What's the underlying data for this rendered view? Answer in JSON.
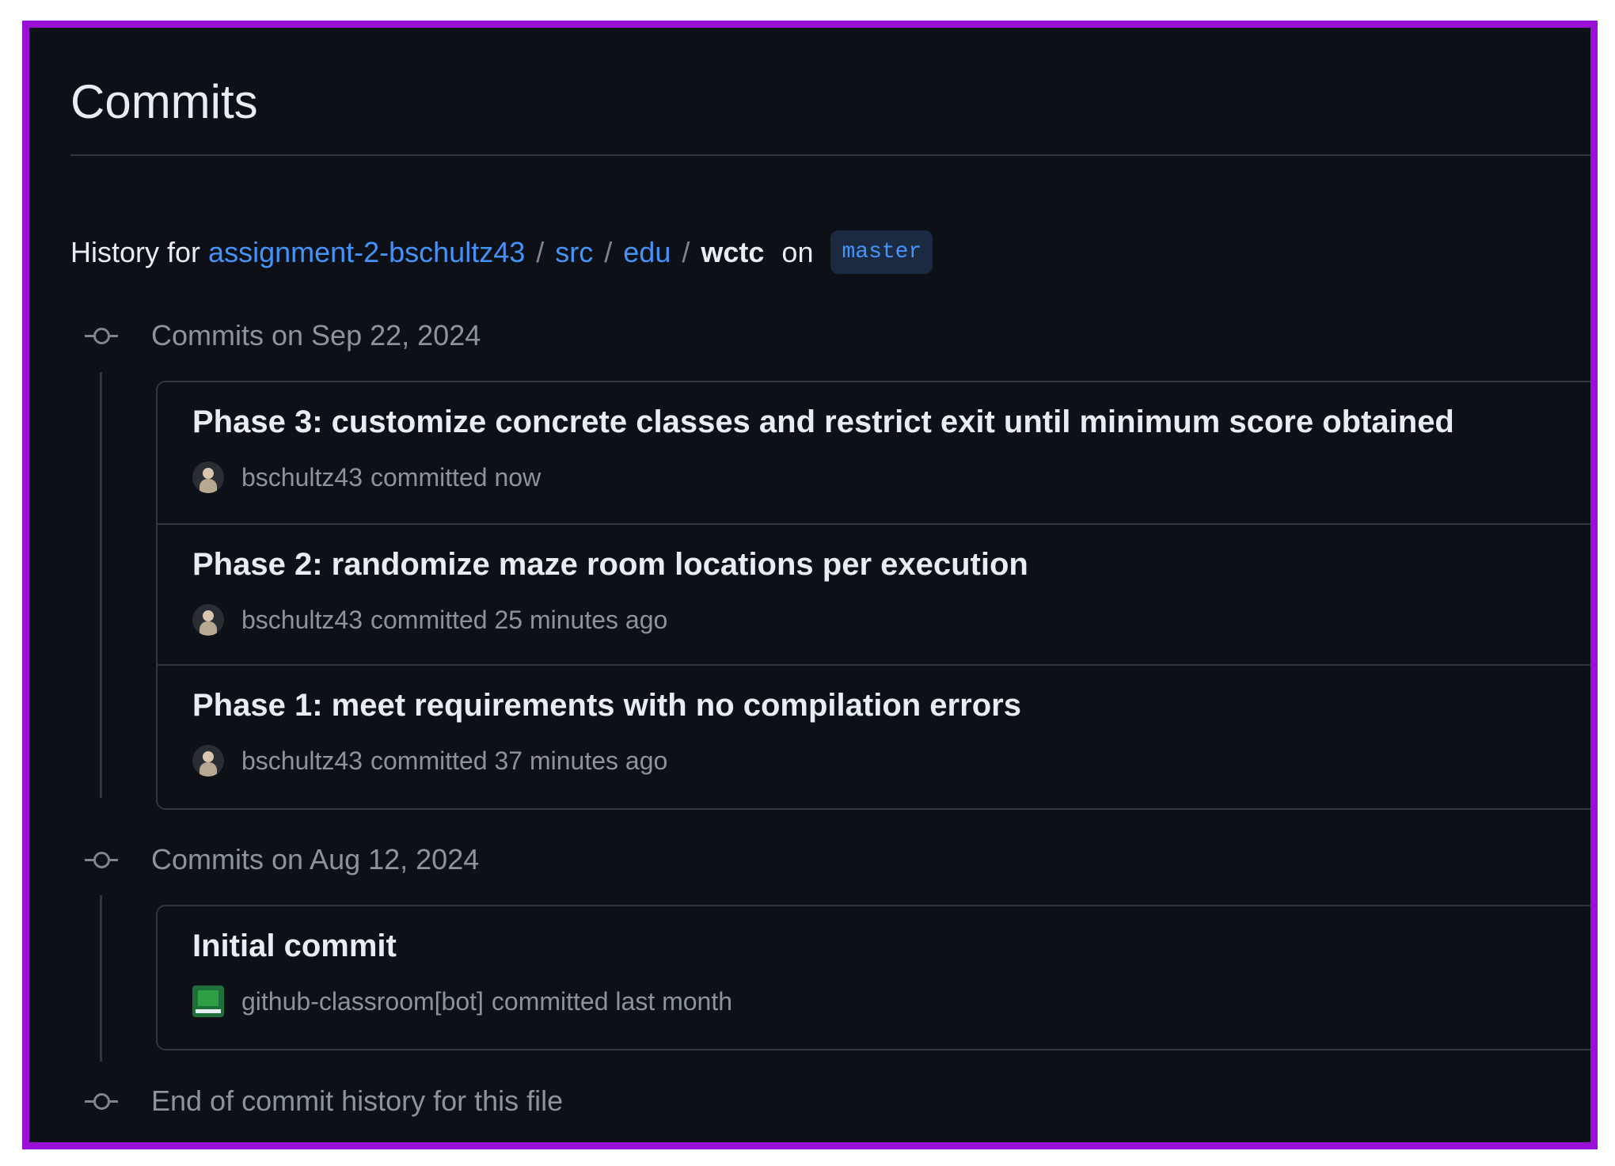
{
  "page": {
    "title": "Commits"
  },
  "history": {
    "prefix": "History for",
    "path": [
      "assignment-2-bschultz43",
      "src",
      "edu"
    ],
    "current": "wctc",
    "separator": "/",
    "on_label": "on",
    "branch": "master"
  },
  "groups": [
    {
      "label": "Commits on Sep 22, 2024",
      "commits": [
        {
          "message": "Phase 3: customize concrete classes and restrict exit until minimum score obtained",
          "author": "bschultz43",
          "action": "committed now",
          "avatar": "user-avatar"
        },
        {
          "message": "Phase 2: randomize maze room locations per execution",
          "author": "bschultz43",
          "action": "committed 25 minutes ago",
          "avatar": "user-avatar"
        },
        {
          "message": "Phase 1: meet requirements with no compilation errors",
          "author": "bschultz43",
          "action": "committed 37 minutes ago",
          "avatar": "user-avatar"
        }
      ]
    },
    {
      "label": "Commits on Aug 12, 2024",
      "commits": [
        {
          "message": "Initial commit",
          "author": "github-classroom[bot]",
          "action": "committed last month",
          "avatar": "bot-avatar"
        }
      ]
    }
  ],
  "end_label": "End of commit history for this file",
  "colors": {
    "background": "#0d1117",
    "link": "#4493f8",
    "text": "#e6edf3",
    "muted": "#8b949e",
    "border": "#30363d",
    "frame": "#9b10d6"
  }
}
